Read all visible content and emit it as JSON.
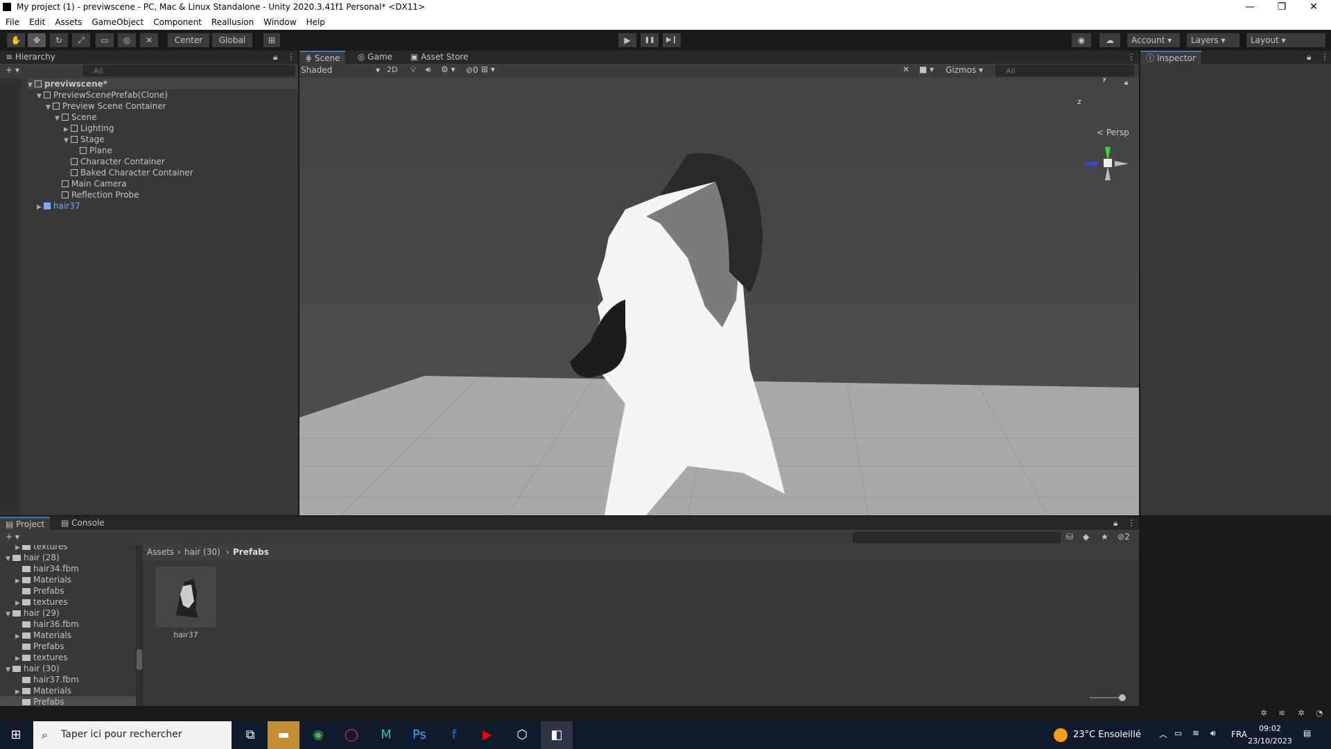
{
  "window": {
    "title": "My project (1) - previwscene - PC, Mac & Linux Standalone - Unity 2020.3.41f1 Personal* <DX11>",
    "minimize": "—",
    "maximize": "❐",
    "close": "✕"
  },
  "menu": [
    "File",
    "Edit",
    "Assets",
    "GameObject",
    "Component",
    "Reallusion",
    "Window",
    "Help"
  ],
  "toolbar": {
    "center": "Center",
    "global": "Global",
    "account": "Account",
    "layers": "Layers",
    "layout": "Layout",
    "play": "▶",
    "pause": "❚❚",
    "step": "▶❙"
  },
  "hierarchy": {
    "tab": "Hierarchy",
    "search_placeholder": "All",
    "add": "+ ▾",
    "items": [
      {
        "label": "previwscene*",
        "indent": 0,
        "arrow": "▼",
        "type": "scene"
      },
      {
        "label": "PreviewScenePrefab(Clone)",
        "indent": 1,
        "arrow": "▼",
        "type": "go"
      },
      {
        "label": "Preview Scene Container",
        "indent": 2,
        "arrow": "▼",
        "type": "go"
      },
      {
        "label": "Scene",
        "indent": 3,
        "arrow": "▼",
        "type": "go"
      },
      {
        "label": "Lighting",
        "indent": 4,
        "arrow": "▶",
        "type": "go"
      },
      {
        "label": "Stage",
        "indent": 4,
        "arrow": "▼",
        "type": "go"
      },
      {
        "label": "Plane",
        "indent": 5,
        "arrow": "",
        "type": "go"
      },
      {
        "label": "Character Container",
        "indent": 4,
        "arrow": "",
        "type": "go"
      },
      {
        "label": "Baked Character Container",
        "indent": 4,
        "arrow": "",
        "type": "go"
      },
      {
        "label": "Main Camera",
        "indent": 3,
        "arrow": "",
        "type": "go"
      },
      {
        "label": "Reflection Probe",
        "indent": 3,
        "arrow": "",
        "type": "go"
      },
      {
        "label": "hair37",
        "indent": 1,
        "arrow": "▶",
        "type": "prefab"
      }
    ]
  },
  "scene": {
    "tabs": [
      "Scene",
      "Game",
      "Asset Store"
    ],
    "shading": "Shaded",
    "mode2d": "2D",
    "hidden_count": "0",
    "gizmos": "Gizmos",
    "search_placeholder": "All",
    "persp": "< Persp",
    "axis_y": "y",
    "axis_z": "z"
  },
  "inspector": {
    "tab": "Inspector"
  },
  "project": {
    "tabs": [
      "Project",
      "Console"
    ],
    "add": "+ ▾",
    "hidden_count": "2",
    "breadcrumb": [
      "Assets",
      "hair (30)",
      "Prefabs"
    ],
    "tree": [
      {
        "label": "textures",
        "indent": 2,
        "arrow": "▶",
        "partial": true
      },
      {
        "label": "hair (28)",
        "indent": 1,
        "arrow": "▼"
      },
      {
        "label": "hair34.fbm",
        "indent": 2,
        "arrow": ""
      },
      {
        "label": "Materials",
        "indent": 2,
        "arrow": "▶"
      },
      {
        "label": "Prefabs",
        "indent": 2,
        "arrow": ""
      },
      {
        "label": "textures",
        "indent": 2,
        "arrow": "▶"
      },
      {
        "label": "hair (29)",
        "indent": 1,
        "arrow": "▼"
      },
      {
        "label": "hair36.fbm",
        "indent": 2,
        "arrow": ""
      },
      {
        "label": "Materials",
        "indent": 2,
        "arrow": "▶"
      },
      {
        "label": "Prefabs",
        "indent": 2,
        "arrow": ""
      },
      {
        "label": "textures",
        "indent": 2,
        "arrow": "▶"
      },
      {
        "label": "hair (30)",
        "indent": 1,
        "arrow": "▼"
      },
      {
        "label": "hair37.fbm",
        "indent": 2,
        "arrow": ""
      },
      {
        "label": "Materials",
        "indent": 2,
        "arrow": "▶"
      },
      {
        "label": "Prefabs",
        "indent": 2,
        "arrow": "",
        "selected": true
      }
    ],
    "assets": [
      {
        "label": "hair37"
      }
    ]
  },
  "taskbar": {
    "search_placeholder": "Taper ici pour rechercher",
    "weather": "23°C  Ensoleillé",
    "lang": "FRA",
    "time": "09:02",
    "date": "23/10/2023"
  },
  "colors": {
    "accent": "#3a79bb",
    "prefab": "#7baaf7",
    "selected": "#2c5d87"
  }
}
